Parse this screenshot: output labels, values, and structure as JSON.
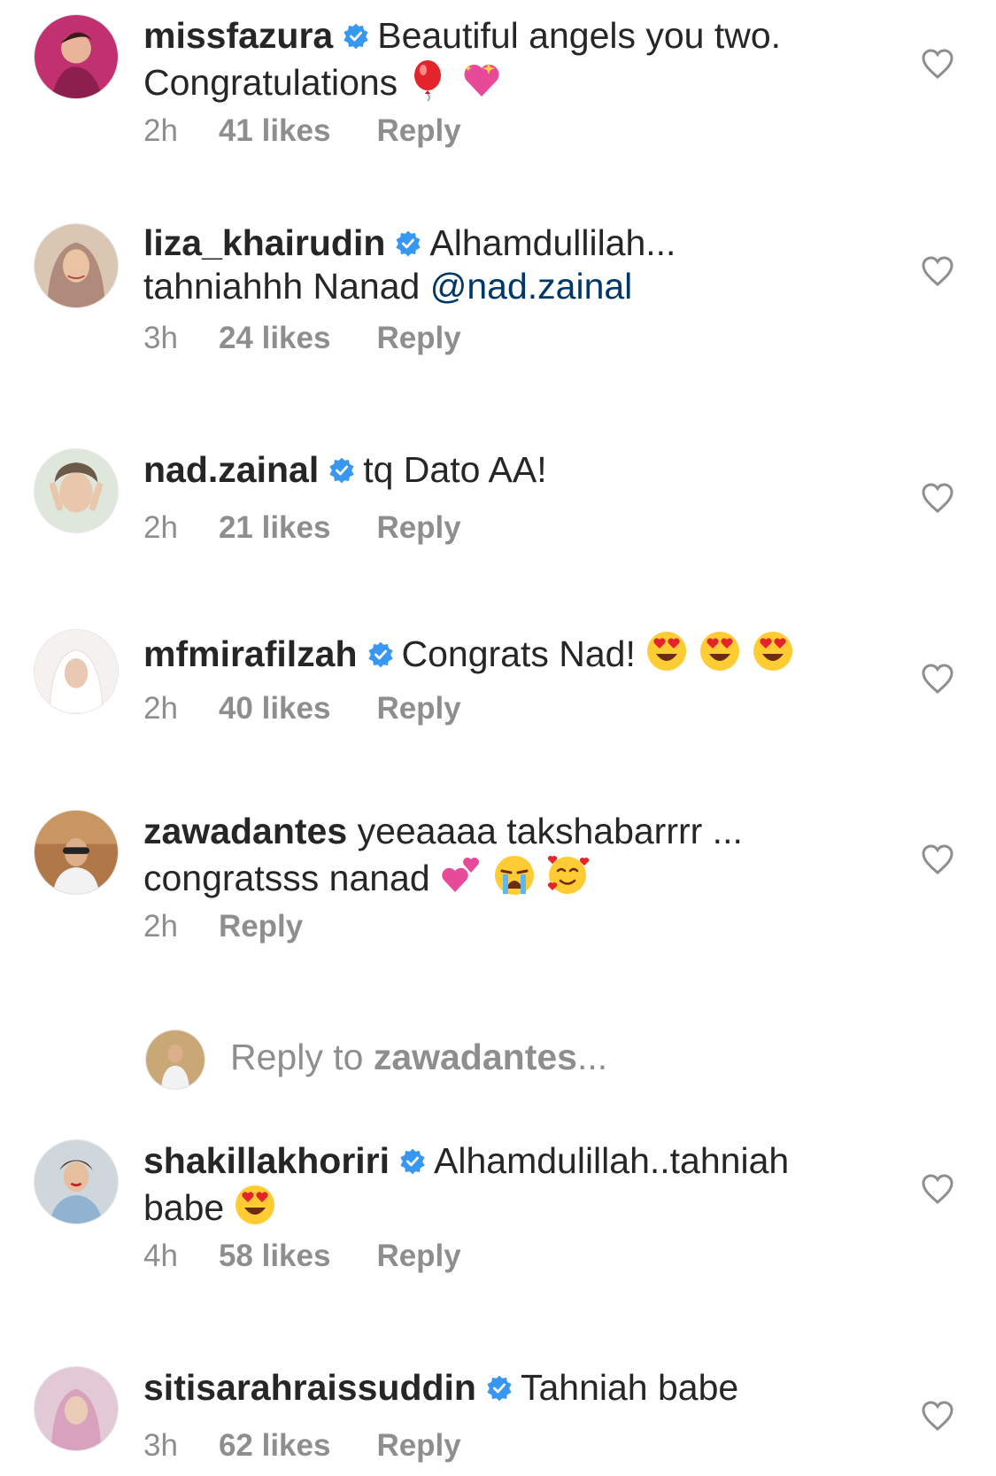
{
  "colors": {
    "text": "#262626",
    "secondary": "#8e8e8e",
    "verified": "#3897f0",
    "mention": "#00376b"
  },
  "comments": [
    {
      "username": "missfazura",
      "verified": true,
      "line1": "Beautiful angels you two.",
      "line2": "Congratulations",
      "emojis": [
        "balloon",
        "sparkling-heart"
      ],
      "time": "2h",
      "likes": "41 likes",
      "reply": "Reply"
    },
    {
      "username": "liza_khairudin",
      "verified": true,
      "line1": "Alhamdullilah...",
      "line2": "tahniahhh Nanad",
      "mention": "@nad.zainal",
      "time": "3h",
      "likes": "24 likes",
      "reply": "Reply"
    },
    {
      "username": "nad.zainal",
      "verified": true,
      "line1": "tq Dato AA!",
      "time": "2h",
      "likes": "21 likes",
      "reply": "Reply"
    },
    {
      "username": "mfmirafilzah",
      "verified": true,
      "line1": "Congrats Nad!",
      "emojis": [
        "heart-eyes",
        "heart-eyes",
        "heart-eyes"
      ],
      "time": "2h",
      "likes": "40 likes",
      "reply": "Reply"
    },
    {
      "username": "zawadantes",
      "verified": false,
      "line1": "yeeaaaa takshabarrrr ...",
      "line2": "congratsss nanad",
      "emojis": [
        "two-hearts",
        "crying-face",
        "smiling-face-with-hearts"
      ],
      "time": "2h",
      "reply": "Reply"
    },
    {
      "username": "shakillakhoriri",
      "verified": true,
      "line1": "Alhamdulillah..tahniah",
      "line2": "babe",
      "emojis": [
        "heart-eyes"
      ],
      "time": "4h",
      "likes": "58 likes",
      "reply": "Reply"
    },
    {
      "username": "sitisarahraissuddin",
      "verified": true,
      "line1": "Tahniah babe",
      "time": "3h",
      "likes": "62 likes",
      "reply": "Reply"
    }
  ],
  "reply_input": {
    "prefix": "Reply to ",
    "username": "zawadantes",
    "suffix": "..."
  }
}
